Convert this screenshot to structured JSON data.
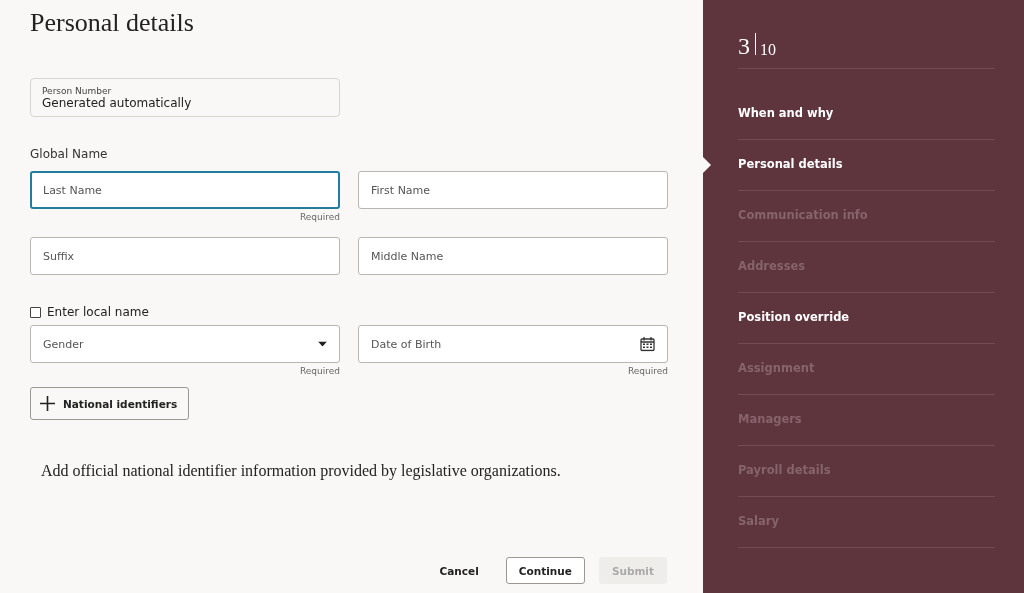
{
  "title": "Personal details",
  "person_number": {
    "label": "Person Number",
    "value": "Generated automatically"
  },
  "global_name": {
    "label": "Global Name",
    "fields": [
      {
        "kind": "text",
        "placeholder": "Last Name",
        "focused": true,
        "note": "Required"
      },
      {
        "kind": "text",
        "placeholder": "First Name",
        "focused": false
      },
      {
        "kind": "text",
        "placeholder": "Suffix",
        "focused": false
      },
      {
        "kind": "text",
        "placeholder": "Middle Name",
        "focused": false
      }
    ]
  },
  "local_name": {
    "label": "Enter local name",
    "checked": false
  },
  "details_fields": [
    {
      "kind": "select",
      "placeholder": "Gender",
      "focused": false,
      "note": "Required"
    },
    {
      "kind": "date",
      "placeholder": "Date of Birth",
      "focused": false,
      "note": "Required"
    }
  ],
  "add_button": {
    "label": "National identifiers"
  },
  "description": "Add official national identifier information provided by legislative organizations.",
  "footer_buttons": [
    {
      "label": "Cancel",
      "kind": "plain",
      "disabled": false
    },
    {
      "label": "Continue",
      "kind": "outlined",
      "disabled": false
    },
    {
      "label": "Submit",
      "kind": "filled",
      "disabled": true
    }
  ],
  "progress": {
    "current": "3",
    "total": "10"
  },
  "steps": [
    {
      "label": "When and why",
      "enabled": true,
      "selected": false
    },
    {
      "label": "Personal details",
      "enabled": true,
      "selected": true
    },
    {
      "label": "Communication info",
      "enabled": false,
      "selected": false
    },
    {
      "label": "Addresses",
      "enabled": false,
      "selected": false
    },
    {
      "label": "Position override",
      "enabled": true,
      "selected": false
    },
    {
      "label": "Assignment",
      "enabled": false,
      "selected": false
    },
    {
      "label": "Managers",
      "enabled": false,
      "selected": false
    },
    {
      "label": "Payroll details",
      "enabled": false,
      "selected": false
    },
    {
      "label": "Salary",
      "enabled": false,
      "selected": false
    }
  ]
}
